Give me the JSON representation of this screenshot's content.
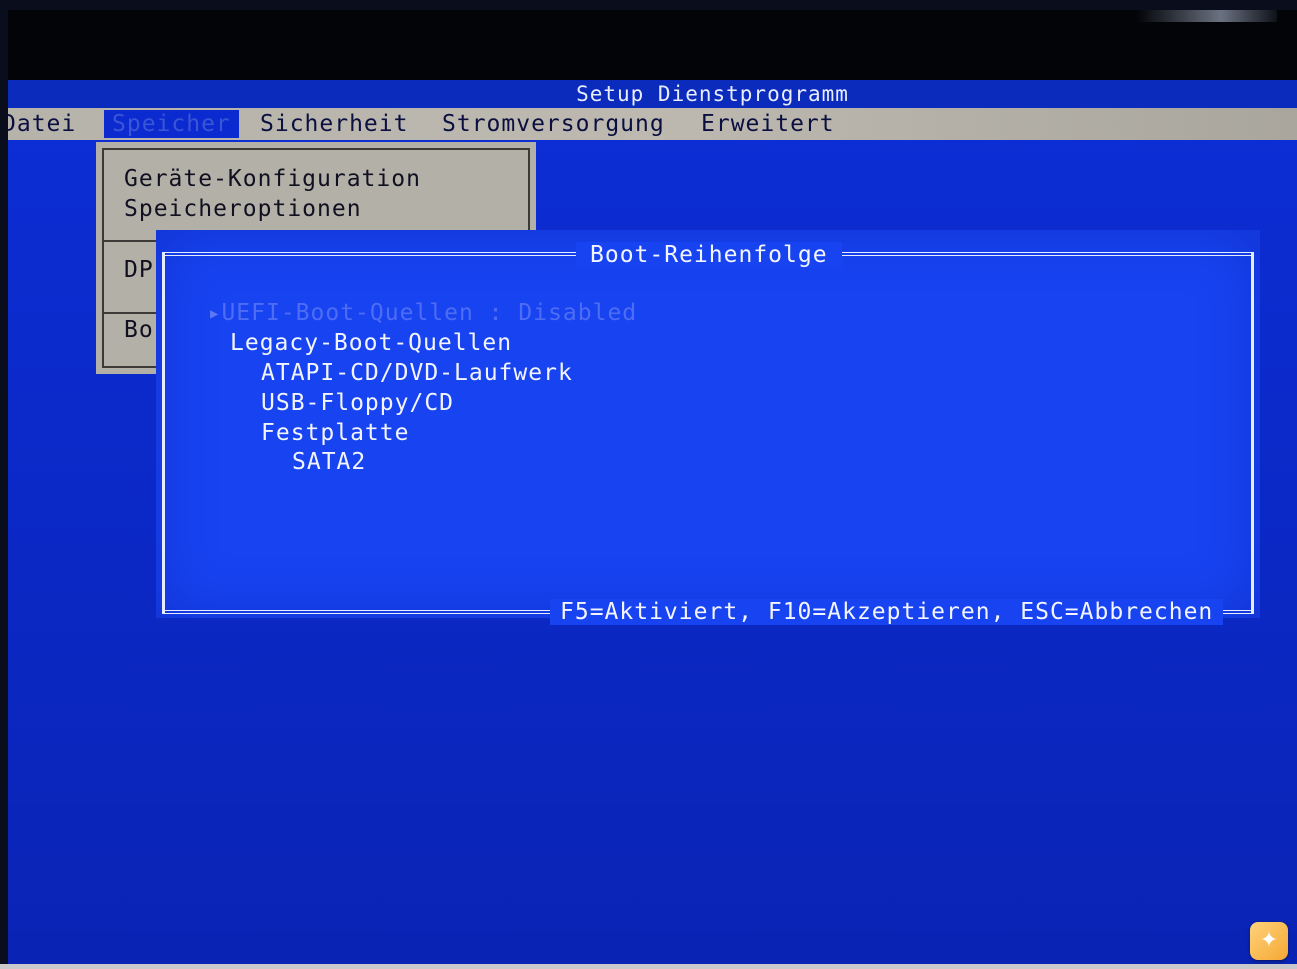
{
  "app": {
    "title": "Setup Dienstprogramm"
  },
  "menu": {
    "items": [
      {
        "label": "Datei"
      },
      {
        "label": "Speicher",
        "active": true
      },
      {
        "label": "Sicherheit"
      },
      {
        "label": "Stromversorgung"
      },
      {
        "label": "Erweitert"
      }
    ]
  },
  "submenu": {
    "items": [
      "Geräte-Konfiguration",
      "Speicheroptionen",
      "DP",
      "Bo"
    ]
  },
  "dialog": {
    "title": "Boot-Reihenfolge",
    "footer": "F5=Aktiviert, F10=Akzeptieren, ESC=Abbrechen",
    "items": [
      {
        "label": "UEFI-Boot-Quellen : Disabled",
        "selected": true,
        "disabled": true
      },
      {
        "label": "Legacy-Boot-Quellen"
      },
      {
        "label": "ATAPI-CD/DVD-Laufwerk"
      },
      {
        "label": "USB-Floppy/CD"
      },
      {
        "label": "Festplatte"
      },
      {
        "label": "SATA2"
      }
    ]
  },
  "colors": {
    "screen_bg": "#0b28c4",
    "dialog_bg": "#1743f0",
    "menu_bar": "#b6b3aa",
    "text_light": "#f2f5ff"
  },
  "icons": {
    "corner": "app-watermark-icon"
  }
}
